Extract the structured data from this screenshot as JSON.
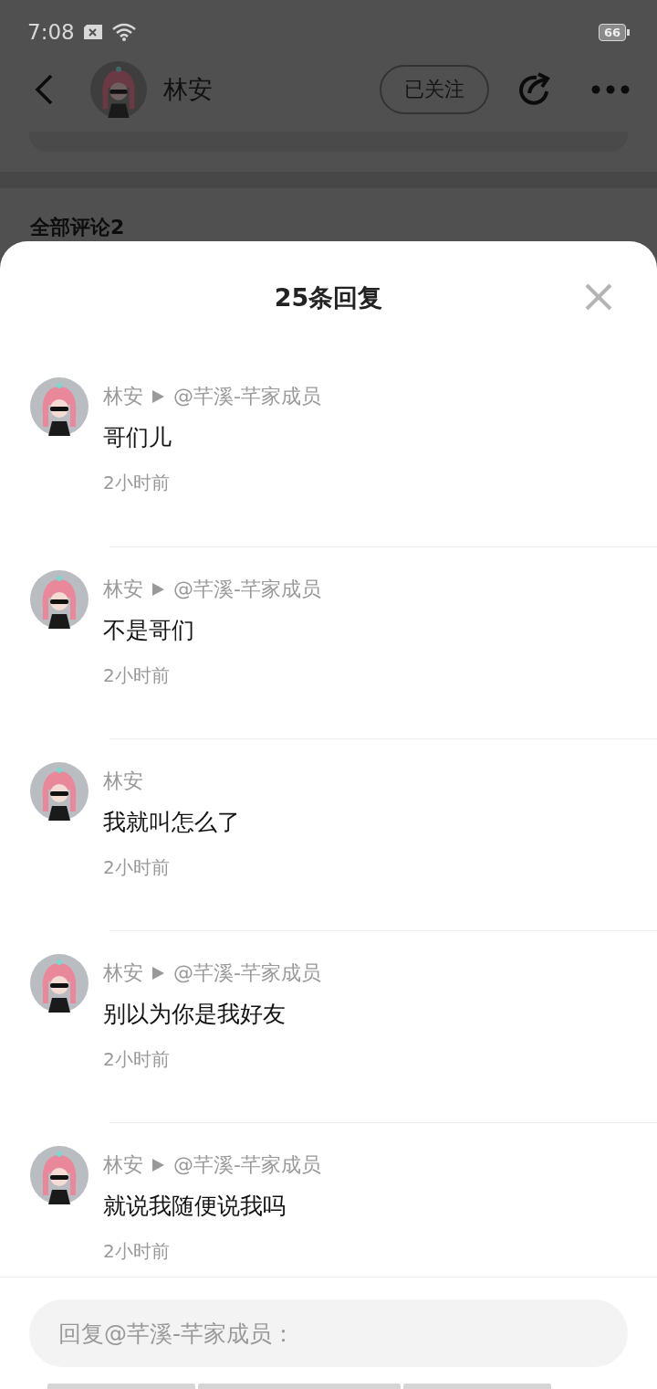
{
  "status_bar": {
    "time": "7:08",
    "battery": "66"
  },
  "header": {
    "user_name": "林安",
    "follow_button": "已关注"
  },
  "background": {
    "section_title": "全部评论2"
  },
  "sheet": {
    "title": "25条回复",
    "replies": [
      {
        "name": "林安",
        "target": "@芊溪-芊家成员",
        "text": "哥们儿",
        "time": "2小时前"
      },
      {
        "name": "林安",
        "target": "@芊溪-芊家成员",
        "text": "不是哥们",
        "time": "2小时前"
      },
      {
        "name": "林安",
        "text": "我就叫怎么了",
        "time": "2小时前"
      },
      {
        "name": "林安",
        "target": "@芊溪-芊家成员",
        "text": "别以为你是我好友",
        "time": "2小时前"
      },
      {
        "name": "林安",
        "target": "@芊溪-芊家成员",
        "text": "就说我随便说我吗",
        "time": "2小时前"
      }
    ],
    "reply_input": {
      "placeholder": "回复@芊溪-芊家成员："
    }
  }
}
